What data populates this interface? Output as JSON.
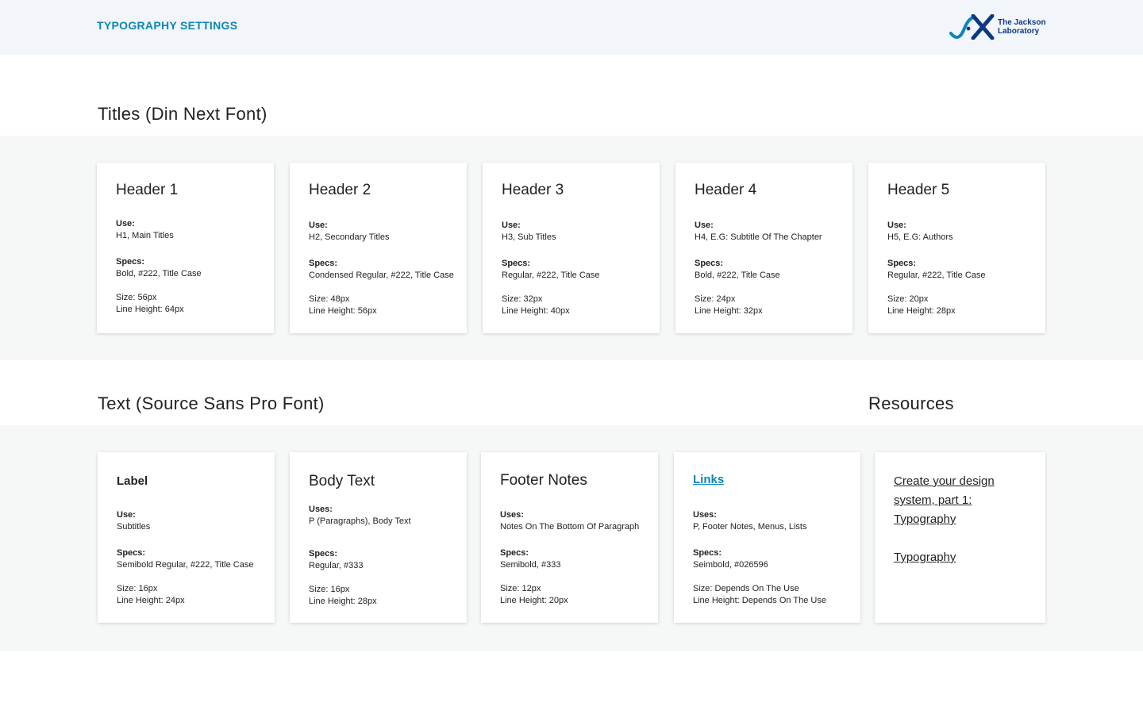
{
  "header": {
    "title": "TYPOGRAPHY SETTINGS",
    "logo_text_line1": "The Jackson",
    "logo_text_line2": "Laboratory"
  },
  "titles_section": {
    "heading": "Titles (Din Next Font)",
    "cards": [
      {
        "title": "Header 1",
        "use_label": "Use:",
        "use": "H1, Main Titles",
        "specs_label": "Specs:",
        "specs": "Bold, #222, Title Case",
        "size": "Size: 56px",
        "line_height": "Line Height: 64px"
      },
      {
        "title": "Header 2",
        "use_label": "Use:",
        "use": "H2, Secondary Titles",
        "specs_label": "Specs:",
        "specs": "Condensed Regular, #222, Title Case",
        "size": "Size: 48px",
        "line_height": "Line Height: 56px"
      },
      {
        "title": "Header 3",
        "use_label": "Use:",
        "use": "H3, Sub Titles",
        "specs_label": "Specs:",
        "specs": "Regular, #222, Title Case",
        "size": "Size: 32px",
        "line_height": "Line Height: 40px"
      },
      {
        "title": "Header 4",
        "use_label": "Use:",
        "use": "H4, E.G: Subtitle Of The Chapter",
        "specs_label": "Specs:",
        "specs": "Bold, #222, Title Case",
        "size": "Size: 24px",
        "line_height": "Line Height: 32px"
      },
      {
        "title": "Header 5",
        "use_label": "Use:",
        "use": "H5, E.G: Authors",
        "specs_label": "Specs:",
        "specs": "Regular, #222, Title Case",
        "size": "Size: 20px",
        "line_height": "Line Height: 28px"
      }
    ]
  },
  "text_section": {
    "heading": "Text (Source Sans Pro Font)",
    "cards": [
      {
        "title": "Label",
        "use_label": "Use:",
        "use": "Subtitles",
        "specs_label": "Specs:",
        "specs": "Semibold Regular, #222, Title Case",
        "size": "Size: 16px",
        "line_height": "Line Height: 24px"
      },
      {
        "title": "Body Text",
        "use_label": "Uses:",
        "use": "P (Paragraphs), Body Text",
        "specs_label": "Specs:",
        "specs": "Regular, #333",
        "size": "Size: 16px",
        "line_height": "Line Height: 28px"
      },
      {
        "title": "Footer Notes",
        "use_label": "Uses:",
        "use": "Notes On The Bottom Of Paragraph",
        "specs_label": "Specs:",
        "specs": "Semibold, #333",
        "size": "Size: 12px",
        "line_height": "Line Height: 20px"
      },
      {
        "title": "Links",
        "use_label": "Uses:",
        "use": "P, Footer Notes, Menus, Lists",
        "specs_label": "Specs:",
        "specs": "Seimbold, #026596",
        "size": "Size: Depends On The Use",
        "line_height": "Line Height: Depends On The Use"
      }
    ]
  },
  "resources": {
    "heading": "Resources",
    "links": [
      "Create your design system, part 1: Typography",
      "Typography"
    ]
  },
  "colors": {
    "accent": "#0a86b8",
    "header_bg": "#f2f6fa",
    "band_bg": "#f6f8f8",
    "logo_dark": "#0a3a82"
  }
}
